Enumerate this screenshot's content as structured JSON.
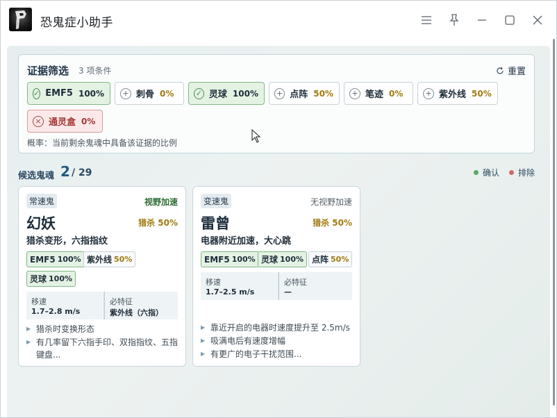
{
  "window": {
    "title": "恐鬼症小助手",
    "controls": [
      "menu-icon",
      "pin-icon",
      "minimize-icon",
      "maximize-icon",
      "close-icon"
    ]
  },
  "filter": {
    "title": "证据筛选",
    "count": "3 项条件",
    "reset_label": "重置",
    "chips": [
      {
        "label": "EMF5",
        "pct": "100%",
        "state": "confirm"
      },
      {
        "label": "刺骨",
        "pct": "0%",
        "state": "neutral"
      },
      {
        "label": "灵球",
        "pct": "100%",
        "state": "confirm"
      },
      {
        "label": "点阵",
        "pct": "50%",
        "state": "neutral"
      },
      {
        "label": "笔迹",
        "pct": "0%",
        "state": "neutral"
      },
      {
        "label": "紫外线",
        "pct": "50%",
        "state": "neutral"
      },
      {
        "label": "通灵盒",
        "pct": "0%",
        "state": "exclude"
      }
    ],
    "note": "概率：当前剩余鬼魂中具备该证据的比例"
  },
  "candidates": {
    "title": "候选鬼魂",
    "count": "2",
    "total": "/ 29",
    "legend_confirm": "确认",
    "legend_exclude": "排除",
    "colors": {
      "confirm": "#5aa864",
      "exclude": "#d16a6a"
    }
  },
  "ghosts": [
    {
      "tag": "常速鬼",
      "speed_note": "视野加速",
      "name": "幻妖",
      "hunt": "猎杀 50%",
      "desc": "猎杀变形，六指指纹",
      "evidence": [
        {
          "label": "EMF5",
          "pct": "100%",
          "confirmed": true
        },
        {
          "label": "紫外线",
          "pct": "50%",
          "confirmed": false
        },
        {
          "label": "灵球",
          "pct": "100%",
          "confirmed": true
        }
      ],
      "speed_key": "移速",
      "speed_val": "1.7–2.8 m/s",
      "must_key": "必特征",
      "must_val": "紫外线（六指）",
      "bullets": [
        "猎杀时变换形态",
        "有几率留下六指手印、双指指纹、五指键盘..."
      ]
    },
    {
      "tag": "变速鬼",
      "speed_note": "无视野加速",
      "name": "雷曾",
      "hunt": "猎杀 50%",
      "desc": "电器附近加速，大心跳",
      "evidence": [
        {
          "label": "EMF5",
          "pct": "100%",
          "confirmed": true
        },
        {
          "label": "灵球",
          "pct": "100%",
          "confirmed": true
        },
        {
          "label": "点阵",
          "pct": "50%",
          "confirmed": false
        }
      ],
      "speed_key": "移速",
      "speed_val": "1.7–2.5 m/s",
      "must_key": "必特征",
      "must_val": "—",
      "bullets": [
        "靠近开启的电器时速度提升至 2.5m/s",
        "吸满电后有速度增幅",
        "有更广的电子干扰范围..."
      ]
    }
  ]
}
